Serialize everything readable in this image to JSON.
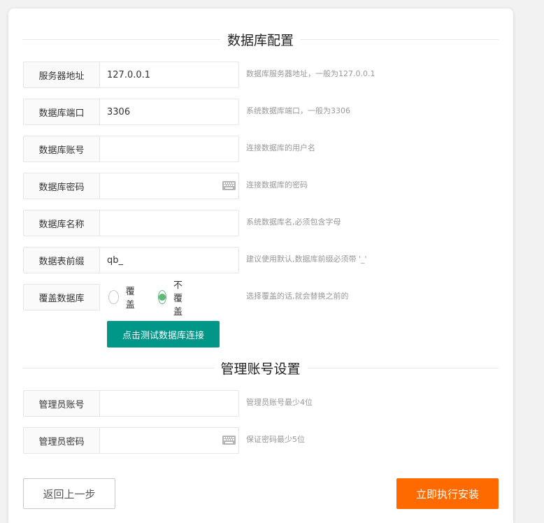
{
  "db_section": {
    "title": "数据库配置"
  },
  "fields": {
    "host": {
      "label": "服务器地址",
      "value": "127.0.0.1",
      "hint": "数据库服务器地址，一般为127.0.0.1"
    },
    "port": {
      "label": "数据库端口",
      "value": "3306",
      "hint": "系统数据库端口，一般为3306"
    },
    "user": {
      "label": "数据库账号",
      "value": "",
      "hint": "连接数据库的用户名"
    },
    "password": {
      "label": "数据库密码",
      "value": "",
      "hint": "连接数据库的密码",
      "icon": "keyboard-icon"
    },
    "dbname": {
      "label": "数据库名称",
      "value": "",
      "hint": "系统数据库名,必须包含字母"
    },
    "prefix": {
      "label": "数据表前缀",
      "value": "qb_",
      "hint": "建议使用默认,数据库前缀必须带 '_'"
    },
    "overwrite": {
      "label": "覆盖数据库",
      "options": [
        "覆盖",
        "不覆盖"
      ],
      "selected": "不覆盖",
      "hint": "选择覆盖的话,就会替换之前的"
    }
  },
  "test_button": {
    "label": "点击测试数据库连接"
  },
  "admin_section": {
    "title": "管理账号设置"
  },
  "admin": {
    "account": {
      "label": "管理员账号",
      "value": "",
      "hint": "管理员账号最少4位"
    },
    "password": {
      "label": "管理员密码",
      "value": "",
      "hint": "保证密码最少5位",
      "icon": "keyboard-icon"
    }
  },
  "footer": {
    "back_label": "返回上一步",
    "install_label": "立即执行安装"
  },
  "colors": {
    "teal": "#009688",
    "orange": "#ff6a00",
    "radio_green": "#5fb878"
  }
}
